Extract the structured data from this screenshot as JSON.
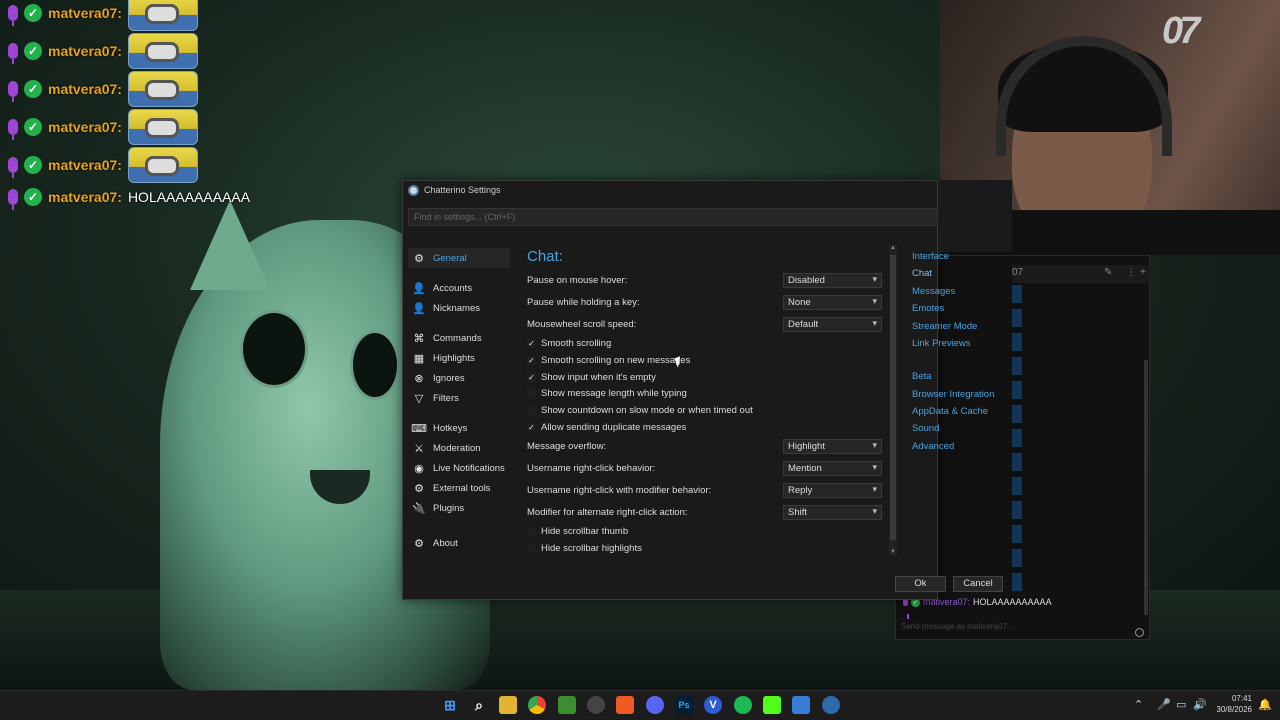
{
  "overlay_chat": {
    "username": "matvera07:",
    "last_message": "HOLAAAAAAAAAA"
  },
  "settings": {
    "window_title": "Chatterino Settings",
    "search_placeholder": "Find in settings... (Ctrl+F)",
    "nav": {
      "general": "General",
      "accounts": "Accounts",
      "nicknames": "Nicknames",
      "commands": "Commands",
      "highlights": "Highlights",
      "ignores": "Ignores",
      "filters": "Filters",
      "hotkeys": "Hotkeys",
      "moderation": "Moderation",
      "live_notifications": "Live Notifications",
      "external_tools": "External tools",
      "plugins": "Plugins",
      "about": "About"
    },
    "section_title": "Chat:",
    "options": {
      "pause_hover": {
        "label": "Pause on mouse hover:",
        "value": "Disabled"
      },
      "pause_key": {
        "label": "Pause while holding a key:",
        "value": "None"
      },
      "scroll_speed": {
        "label": "Mousewheel scroll speed:",
        "value": "Default"
      },
      "smooth_scrolling": {
        "label": "Smooth scrolling",
        "checked": true
      },
      "smooth_new": {
        "label": "Smooth scrolling on new messages",
        "checked": true
      },
      "show_input": {
        "label": "Show input when it's empty",
        "checked": true
      },
      "msg_length": {
        "label": "Show message length while typing",
        "checked": false
      },
      "countdown": {
        "label": "Show countdown on slow mode or when timed out",
        "checked": false
      },
      "duplicates": {
        "label": "Allow sending duplicate messages",
        "checked": true
      },
      "overflow": {
        "label": "Message overflow:",
        "value": "Highlight"
      },
      "rightclick": {
        "label": "Username right-click behavior:",
        "value": "Mention"
      },
      "rightclick_mod": {
        "label": "Username right-click with modifier behavior:",
        "value": "Reply"
      },
      "modifier_alt": {
        "label": "Modifier for alternate right-click action:",
        "value": "Shift"
      },
      "hide_thumb": {
        "label": "Hide scrollbar thumb",
        "checked": false
      },
      "hide_highlights": {
        "label": "Hide scrollbar highlights",
        "checked": false
      }
    },
    "subnav": {
      "interface": "Interface",
      "chat": "Chat",
      "messages": "Messages",
      "emotes": "Emotes",
      "streamer_mode": "Streamer Mode",
      "link_previews": "Link Previews",
      "beta": "Beta",
      "browser_integration": "Browser Integration",
      "appdata_cache": "AppData & Cache",
      "sound": "Sound",
      "advanced": "Advanced"
    },
    "ok": "Ok",
    "cancel": "Cancel"
  },
  "side_split": {
    "tab_label": "07",
    "message_user": "mativera07:",
    "message_text": "HOLAAAAAAAAAA",
    "input_placeholder": "Send message as mativera07..."
  },
  "webcam": {
    "balloon_text": "07"
  },
  "taskbar": {
    "time": "07:41",
    "date": "30/8/2026",
    "icons": [
      "windows-start-icon",
      "search-icon",
      "file-explorer-icon",
      "chrome-icon",
      "minecraft-icon",
      "obs-icon",
      "brave-icon",
      "discord-icon",
      "photoshop-icon",
      "vpn-icon",
      "spotify-icon",
      "kick-icon",
      "remote-icon",
      "chatterino-icon"
    ],
    "photoshop_label": "Ps",
    "vpn_label": "V"
  }
}
